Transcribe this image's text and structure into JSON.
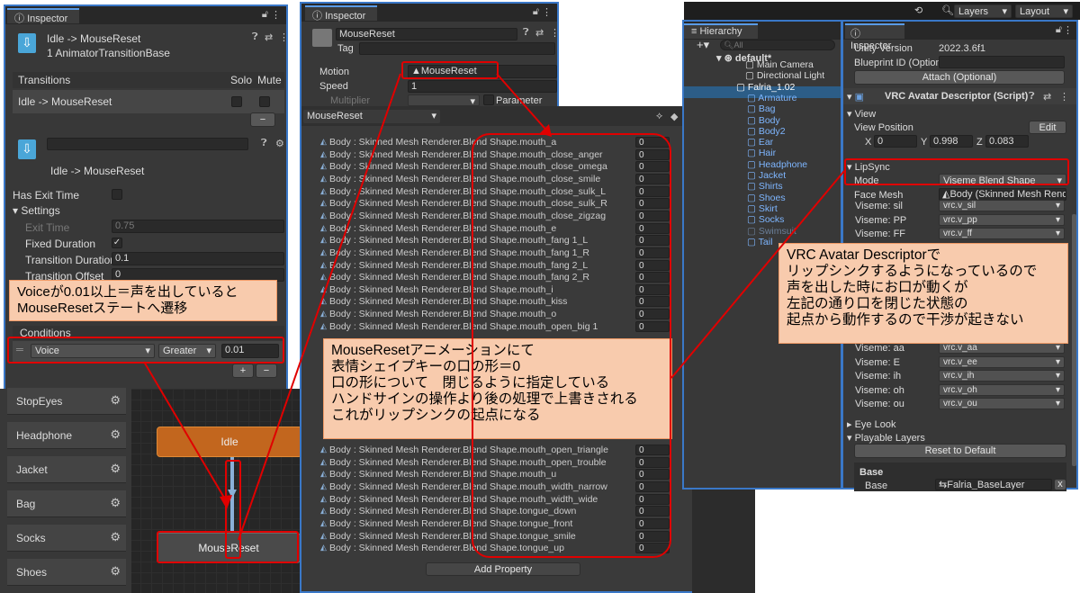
{
  "left_inspector": {
    "tab": "Inspector",
    "title": "Idle -> MouseReset",
    "subtitle": "1 AnimatorTransitionBase",
    "transitions_header": "Transitions",
    "solo": "Solo",
    "mute": "Mute",
    "transition_row": "Idle -> MouseReset",
    "transition_name": "Idle -> MouseReset",
    "has_exit_time": "Has Exit Time",
    "settings": "Settings",
    "exit_time_label": "Exit Time",
    "exit_time_value": "0.75",
    "fixed_duration": "Fixed Duration",
    "transition_duration_label": "Transition Duration",
    "transition_duration_value": "0.1",
    "transition_offset_label": "Transition Offset",
    "transition_offset_value": "0",
    "conditions": "Conditions",
    "cond_param": "Voice",
    "cond_op": "Greater",
    "cond_value": "0.01",
    "plus": "+",
    "minus": "−"
  },
  "layers": [
    {
      "name": "StopEyes"
    },
    {
      "name": "Headphone"
    },
    {
      "name": "Jacket"
    },
    {
      "name": "Bag"
    },
    {
      "name": "Socks"
    },
    {
      "name": "Shoes"
    }
  ],
  "graph": {
    "idle": "Idle",
    "mousereset": "MouseReset"
  },
  "mid_inspector": {
    "tab": "Inspector",
    "name": "MouseReset",
    "tag_label": "Tag",
    "motion_label": "Motion",
    "motion_value": "MouseReset",
    "speed_label": "Speed",
    "speed_value": "1",
    "multiplier_label": "Multiplier",
    "parameter_label": "Parameter"
  },
  "animation": {
    "clip": "MouseReset",
    "add_property": "Add Property",
    "properties": [
      {
        "name": "Body : Skinned Mesh Renderer.Blend Shape.mouth_a",
        "value": "0"
      },
      {
        "name": "Body : Skinned Mesh Renderer.Blend Shape.mouth_close_anger",
        "value": "0"
      },
      {
        "name": "Body : Skinned Mesh Renderer.Blend Shape.mouth_close_omega",
        "value": "0"
      },
      {
        "name": "Body : Skinned Mesh Renderer.Blend Shape.mouth_close_smile",
        "value": "0"
      },
      {
        "name": "Body : Skinned Mesh Renderer.Blend Shape.mouth_close_sulk_L",
        "value": "0"
      },
      {
        "name": "Body : Skinned Mesh Renderer.Blend Shape.mouth_close_sulk_R",
        "value": "0"
      },
      {
        "name": "Body : Skinned Mesh Renderer.Blend Shape.mouth_close_zigzag",
        "value": "0"
      },
      {
        "name": "Body : Skinned Mesh Renderer.Blend Shape.mouth_e",
        "value": "0"
      },
      {
        "name": "Body : Skinned Mesh Renderer.Blend Shape.mouth_fang 1_L",
        "value": "0"
      },
      {
        "name": "Body : Skinned Mesh Renderer.Blend Shape.mouth_fang 1_R",
        "value": "0"
      },
      {
        "name": "Body : Skinned Mesh Renderer.Blend Shape.mouth_fang 2_L",
        "value": "0"
      },
      {
        "name": "Body : Skinned Mesh Renderer.Blend Shape.mouth_fang 2_R",
        "value": "0"
      },
      {
        "name": "Body : Skinned Mesh Renderer.Blend Shape.mouth_i",
        "value": "0"
      },
      {
        "name": "Body : Skinned Mesh Renderer.Blend Shape.mouth_kiss",
        "value": "0"
      },
      {
        "name": "Body : Skinned Mesh Renderer.Blend Shape.mouth_o",
        "value": "0"
      },
      {
        "name": "Body : Skinned Mesh Renderer.Blend Shape.mouth_open_big 1",
        "value": "0"
      }
    ],
    "properties2": [
      {
        "name": "Body : Skinned Mesh Renderer.Blend Shape.mouth_open_triangle",
        "value": "0"
      },
      {
        "name": "Body : Skinned Mesh Renderer.Blend Shape.mouth_open_trouble",
        "value": "0"
      },
      {
        "name": "Body : Skinned Mesh Renderer.Blend Shape.mouth_u",
        "value": "0"
      },
      {
        "name": "Body : Skinned Mesh Renderer.Blend Shape.mouth_width_narrow",
        "value": "0"
      },
      {
        "name": "Body : Skinned Mesh Renderer.Blend Shape.mouth_width_wide",
        "value": "0"
      },
      {
        "name": "Body : Skinned Mesh Renderer.Blend Shape.tongue_down",
        "value": "0"
      },
      {
        "name": "Body : Skinned Mesh Renderer.Blend Shape.tongue_front",
        "value": "0"
      },
      {
        "name": "Body : Skinned Mesh Renderer.Blend Shape.tongue_smile",
        "value": "0"
      },
      {
        "name": "Body : Skinned Mesh Renderer.Blend Shape.tongue_up",
        "value": "0"
      }
    ]
  },
  "toolbar": {
    "layers": "Layers",
    "layout": "Layout"
  },
  "hierarchy": {
    "tab": "Hierarchy",
    "search_placeholder": "All",
    "scene": "default*",
    "items": [
      "Main Camera",
      "Directional Light",
      "Falria_1.02",
      "Armature",
      "Bag",
      "Body",
      "Body2",
      "Ear",
      "Hair",
      "Headphone",
      "Jacket",
      "Shirts",
      "Shoes",
      "Skirt",
      "Socks",
      "Swimsuit",
      "Tail"
    ]
  },
  "right_inspector": {
    "tab": "Inspector",
    "unity_version_label": "Unity Version",
    "unity_version_value": "2022.3.6f1",
    "blueprint_label": "Blueprint ID (Optional",
    "attach_button": "Attach (Optional)",
    "component": "VRC Avatar Descriptor (Script)",
    "view": "View",
    "view_position": "View Position",
    "edit_button": "Edit",
    "x_label": "X",
    "x_value": "0",
    "y_label": "Y",
    "y_value": "0.998",
    "z_label": "Z",
    "z_value": "0.083",
    "lipsync": "LipSync",
    "mode_label": "Mode",
    "mode_value": "Viseme Blend Shape",
    "face_mesh_label": "Face Mesh",
    "face_mesh_value": "Body (Skinned Mesh Rende",
    "visemes": [
      {
        "label": "Viseme: sil",
        "value": "vrc.v_sil"
      },
      {
        "label": "Viseme: PP",
        "value": "vrc.v_pp"
      },
      {
        "label": "Viseme: FF",
        "value": "vrc.v_ff"
      }
    ],
    "visemes2": [
      {
        "label": "Viseme: aa",
        "value": "vrc.v_aa"
      },
      {
        "label": "Viseme: E",
        "value": "vrc.v_ee"
      },
      {
        "label": "Viseme: ih",
        "value": "vrc.v_ih"
      },
      {
        "label": "Viseme: oh",
        "value": "vrc.v_oh"
      },
      {
        "label": "Viseme: ou",
        "value": "vrc.v_ou"
      }
    ],
    "eye_look": "Eye Look",
    "playable_layers": "Playable Layers",
    "reset_button": "Reset to Default",
    "base_header": "Base",
    "base_label": "Base",
    "base_value": "Falria_BaseLayer"
  },
  "callouts": {
    "voice": "Voiceが0.01以上＝声を出していると\nMouseResetステートへ遷移",
    "mousereset": "MouseResetアニメーションにて\n表情シェイプキーの口の形＝0\n口の形について　閉じるように指定している\nハンドサインの操作より後の処理で上書きされる\nこれがリップシンクの起点になる",
    "vrc": "VRC Avatar Descriptorで\nリップシンクするようになっているので\n声を出した時にお口が動くが\n左記の通り口を閉じた状態の\n起点から動作するので干渉が起きない"
  }
}
